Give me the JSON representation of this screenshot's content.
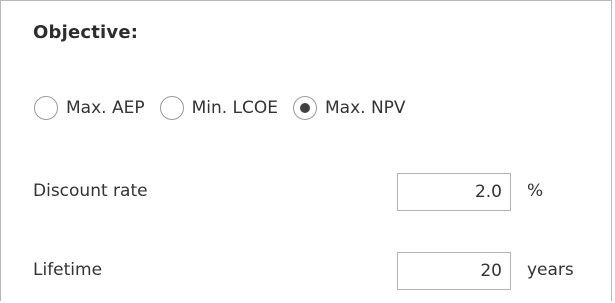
{
  "objective": {
    "title": "Objective:",
    "options": [
      {
        "label": "Max. AEP",
        "selected": false
      },
      {
        "label": "Min. LCOE",
        "selected": false
      },
      {
        "label": "Max. NPV",
        "selected": true
      }
    ]
  },
  "discount_rate": {
    "label": "Discount rate",
    "value": "2.0",
    "unit": "%"
  },
  "lifetime": {
    "label": "Lifetime",
    "value": "20",
    "unit": "years"
  }
}
